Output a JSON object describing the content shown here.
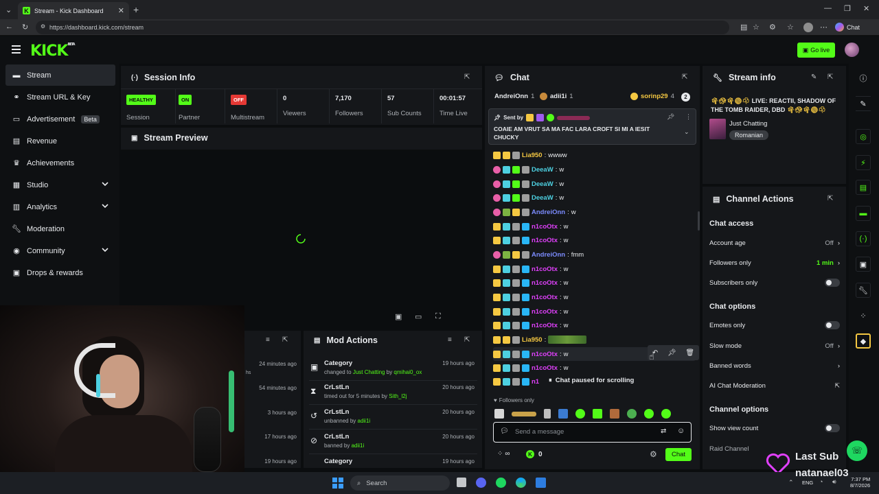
{
  "browser": {
    "tab_title": "Stream - Kick Dashboard",
    "url": "https://dashboard.kick.com/stream",
    "chat_button": "Chat"
  },
  "header": {
    "logo": "KICK",
    "logo_badge": "BETA",
    "go_live": "Go live"
  },
  "sidebar": {
    "items": [
      {
        "label": "Stream",
        "icon": "stream-icon"
      },
      {
        "label": "Stream URL & Key",
        "icon": "link-icon"
      },
      {
        "label": "Advertisement",
        "icon": "tv-icon",
        "badge": "Beta"
      },
      {
        "label": "Revenue",
        "icon": "revenue-icon"
      },
      {
        "label": "Achievements",
        "icon": "trophy-icon"
      },
      {
        "label": "Studio",
        "icon": "studio-icon"
      },
      {
        "label": "Analytics",
        "icon": "analytics-icon"
      },
      {
        "label": "Moderation",
        "icon": "wrench-icon"
      },
      {
        "label": "Community",
        "icon": "community-icon"
      },
      {
        "label": "Drops & rewards",
        "icon": "gift-icon"
      }
    ]
  },
  "session": {
    "title": "Session Info",
    "stats": [
      {
        "value": "HEALTHY",
        "label": "Session",
        "pill_color": "#53fc18"
      },
      {
        "value": "ON",
        "label": "Partner",
        "pill_color": "#53fc18"
      },
      {
        "value": "OFF",
        "label": "Multistream",
        "pill_color": "#e53935"
      },
      {
        "value": "0",
        "label": "Viewers"
      },
      {
        "value": "7,170",
        "label": "Followers"
      },
      {
        "value": "57",
        "label": "Sub Counts"
      },
      {
        "value": "00:01:57",
        "label": "Time Live"
      }
    ]
  },
  "preview": {
    "title": "Stream Preview"
  },
  "left_log": {
    "times": [
      "24 minutes ago",
      "54 minutes ago",
      "3 hours ago",
      "17 hours ago",
      "19 hours ago"
    ],
    "fragment": "hs"
  },
  "mod_actions": {
    "title": "Mod Actions",
    "items": [
      {
        "title": "Category",
        "pre": "changed to ",
        "a": "Just Chatting",
        "mid": " by ",
        "b": "qmihai0_ox",
        "time": "19 hours ago",
        "icon": "category-icon"
      },
      {
        "title": "CrLstLn",
        "pre": "timed out for 5 minutes by ",
        "a": "Sith_l2j",
        "mid": "",
        "b": "",
        "time": "20 hours ago",
        "icon": "hourglass-icon"
      },
      {
        "title": "CrLstLn",
        "pre": "unbanned by ",
        "a": "adii1i",
        "mid": "",
        "b": "",
        "time": "20 hours ago",
        "icon": "unban-icon"
      },
      {
        "title": "CrLstLn",
        "pre": "banned by ",
        "a": "adii1i",
        "mid": "",
        "b": "",
        "time": "20 hours ago",
        "icon": "ban-icon"
      },
      {
        "title": "Category",
        "pre": "",
        "a": "",
        "mid": "",
        "b": "",
        "time": "19 hours ago",
        "icon": "category-icon"
      }
    ]
  },
  "chat": {
    "title": "Chat",
    "top_gifters": [
      {
        "name": "AndreiOnn",
        "count": "1"
      },
      {
        "name": "adii1i",
        "count": "1"
      },
      {
        "name": "sorinp29",
        "count": "4"
      }
    ],
    "gifter_more": "2",
    "pinned": {
      "sent_by": "Sent by",
      "text": "COAIE AM VRUT SA MA FAC LARA CROFT SI MI A IESIT CHUCKY"
    },
    "messages": [
      {
        "user": "Lia950",
        "color": "#f5c842",
        "text": "wwww"
      },
      {
        "user": "DeeaW",
        "color": "#4dd0e1",
        "text": "w"
      },
      {
        "user": "DeeaW",
        "color": "#4dd0e1",
        "text": "w"
      },
      {
        "user": "DeeaW",
        "color": "#4dd0e1",
        "text": "w"
      },
      {
        "user": "AndreiOnn",
        "color": "#7c8cff",
        "text": "w"
      },
      {
        "user": "n1coOtx",
        "color": "#e040fb",
        "text": "w"
      },
      {
        "user": "n1coOtx",
        "color": "#e040fb",
        "text": "w"
      },
      {
        "user": "AndreiOnn",
        "color": "#7c8cff",
        "text": "fmm"
      },
      {
        "user": "n1coOtx",
        "color": "#e040fb",
        "text": "w"
      },
      {
        "user": "n1coOtx",
        "color": "#e040fb",
        "text": "w"
      },
      {
        "user": "n1coOtx",
        "color": "#e040fb",
        "text": "w"
      },
      {
        "user": "n1coOtx",
        "color": "#e040fb",
        "text": "w"
      },
      {
        "user": "n1coOtx",
        "color": "#e040fb",
        "text": "w"
      },
      {
        "user": "Lia950",
        "color": "#f5c842",
        "text": ""
      },
      {
        "user": "n1coOtx",
        "color": "#e040fb",
        "text": "w"
      },
      {
        "user": "n1coOtx",
        "color": "#e040fb",
        "text": "w"
      }
    ],
    "partial_user": "n1",
    "paused": "Chat paused for scrolling",
    "mode": "Followers only",
    "input_placeholder": "Send a message",
    "points": "0",
    "send": "Chat"
  },
  "stream_info": {
    "title": "Stream info",
    "stream_title": "LIVE: REACTII, SHADOW OF THE TOMB RAIDER, DBD",
    "category": "Just Chatting",
    "tag": "Romanian"
  },
  "channel_actions": {
    "title": "Channel Actions",
    "chat_access": "Chat access",
    "account_age": {
      "label": "Account age",
      "value": "Off"
    },
    "followers_only": {
      "label": "Followers only",
      "value": "1 min"
    },
    "subscribers_only": {
      "label": "Subscribers only"
    },
    "chat_options": "Chat options",
    "emotes_only": {
      "label": "Emotes only"
    },
    "slow_mode": {
      "label": "Slow mode",
      "value": "Off"
    },
    "banned_words": {
      "label": "Banned words"
    },
    "ai_moderation": {
      "label": "AI Chat Moderation"
    },
    "channel_options": "Channel options",
    "show_view_count": {
      "label": "Show view count"
    },
    "raid_channel": {
      "label": "Raid Channel"
    }
  },
  "overlay": {
    "last_sub_label": "Last Sub",
    "last_sub_name": "natanael03"
  },
  "taskbar": {
    "search": "Search",
    "lang": "ENG",
    "time": "7:37 PM",
    "date": "8/7/2026"
  }
}
